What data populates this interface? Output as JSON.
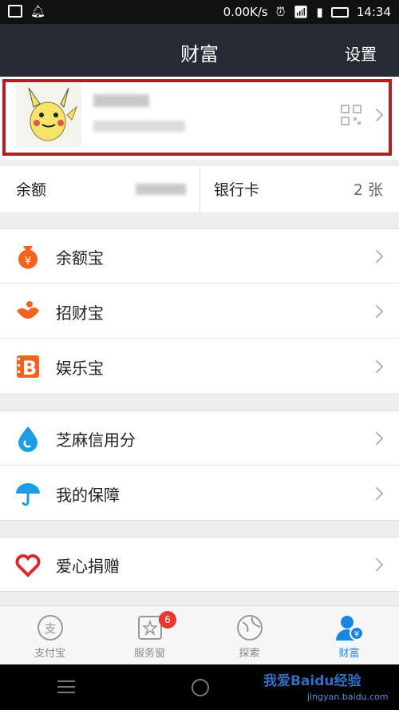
{
  "status_bar": {
    "network_speed": "0.00K/s",
    "time": "14:34"
  },
  "header": {
    "title": "财富",
    "settings_label": "设置"
  },
  "balance": {
    "balance_label": "余额",
    "bank_card_label": "银行卡",
    "bank_card_count": "2 张"
  },
  "menu_groups": [
    [
      {
        "label": "余额宝",
        "icon": "yuebao-icon",
        "color": "#f2631f"
      },
      {
        "label": "招财宝",
        "icon": "zhaocaibao-icon",
        "color": "#f2631f"
      },
      {
        "label": "娱乐宝",
        "icon": "yulebao-icon",
        "color": "#f2631f"
      }
    ],
    [
      {
        "label": "芝麻信用分",
        "icon": "sesame-credit-icon",
        "color": "#1d9be3"
      },
      {
        "label": "我的保障",
        "icon": "umbrella-icon",
        "color": "#1d9be3"
      }
    ],
    [
      {
        "label": "爱心捐赠",
        "icon": "heart-icon",
        "color": "#e2262c"
      }
    ]
  ],
  "tabs": [
    {
      "label": "支付宝",
      "icon": "alipay-icon"
    },
    {
      "label": "服务窗",
      "icon": "service-window-icon",
      "badge": "6"
    },
    {
      "label": "探索",
      "icon": "explore-icon"
    },
    {
      "label": "财富",
      "icon": "wealth-icon",
      "active": true
    }
  ],
  "watermark": {
    "text": "我爱Baidu经验",
    "sub": "jingyan.baidu.com"
  },
  "colors": {
    "title_bar": "#262a33",
    "accent_orange": "#f2631f",
    "accent_blue": "#1d9be3",
    "highlight_frame": "#b51c24"
  }
}
